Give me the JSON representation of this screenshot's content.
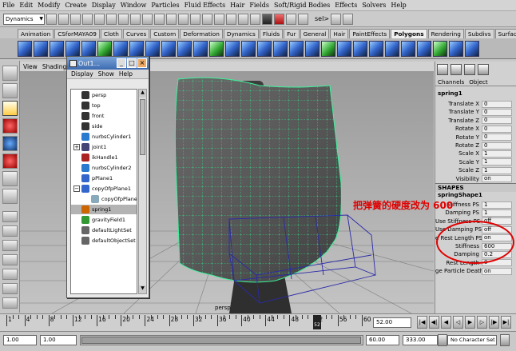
{
  "menubar": [
    "File",
    "Edit",
    "Modify",
    "Create",
    "Display",
    "Window",
    "Particles",
    "Fluid Effects",
    "Hair",
    "Fields",
    "Soft/Rigid Bodies",
    "Effects",
    "Solvers",
    "Help"
  ],
  "status": {
    "mode": "Dynamics",
    "sel_label": "sel>"
  },
  "shelf_tabs": [
    "Animation",
    "CSforMAYA09",
    "Cloth",
    "Curves",
    "Custom",
    "Deformation",
    "Dynamics",
    "Fluids",
    "Fur",
    "General",
    "Hair",
    "PaintEffects",
    "Polygons",
    "Rendering",
    "Subdivs",
    "Surfaces"
  ],
  "shelf_active": "Polygons",
  "viewport": {
    "menu": [
      "View",
      "Shading"
    ],
    "camera_label": "persp"
  },
  "outliner": {
    "title": "Out1...",
    "menu": [
      "Display",
      "Show",
      "Help"
    ],
    "items": [
      {
        "name": "persp",
        "icon": "camera-icon",
        "expander": ""
      },
      {
        "name": "top",
        "icon": "camera-icon",
        "expander": ""
      },
      {
        "name": "front",
        "icon": "camera-icon",
        "expander": ""
      },
      {
        "name": "side",
        "icon": "camera-icon",
        "expander": ""
      },
      {
        "name": "nurbsCylinder1",
        "icon": "nurbs-icon",
        "expander": ""
      },
      {
        "name": "joint1",
        "icon": "joint-icon",
        "expander": "+"
      },
      {
        "name": "ikHandle1",
        "icon": "ik-handle-icon",
        "expander": ""
      },
      {
        "name": "nurbsCylinder2",
        "icon": "nurbs-icon",
        "expander": ""
      },
      {
        "name": "pPlane1",
        "icon": "poly-icon",
        "expander": ""
      },
      {
        "name": "copyOfpPlane1",
        "icon": "poly-icon",
        "expander": "−"
      },
      {
        "name": "copyOfpPlane",
        "icon": "poly-shape-icon",
        "expander": ""
      },
      {
        "name": "spring1",
        "icon": "spring-icon",
        "expander": ""
      },
      {
        "name": "gravityField1",
        "icon": "field-icon",
        "expander": ""
      },
      {
        "name": "defaultLightSet",
        "icon": "set-icon",
        "expander": ""
      },
      {
        "name": "defaultObjectSet",
        "icon": "set-icon",
        "expander": ""
      }
    ]
  },
  "channel_box": {
    "tabs": [
      "Channels",
      "Object"
    ],
    "node": "spring1",
    "attrs": [
      {
        "label": "Translate X",
        "value": "0"
      },
      {
        "label": "Translate Y",
        "value": "0"
      },
      {
        "label": "Translate Z",
        "value": "0"
      },
      {
        "label": "Rotate X",
        "value": "0"
      },
      {
        "label": "Rotate Y",
        "value": "0"
      },
      {
        "label": "Rotate Z",
        "value": "0"
      },
      {
        "label": "Scale X",
        "value": "1"
      },
      {
        "label": "Scale Y",
        "value": "1"
      },
      {
        "label": "Scale Z",
        "value": "1"
      },
      {
        "label": "Visibility",
        "value": "on"
      }
    ],
    "shapes_label": "SHAPES",
    "shape_node": "springShape1",
    "shape_attrs": [
      {
        "label": "Stiffness PS",
        "value": "1"
      },
      {
        "label": "Damping PS",
        "value": "1"
      },
      {
        "label": "Use Stiffness PS",
        "value": "off"
      },
      {
        "label": "Use Damping PS",
        "value": "off"
      },
      {
        "label": "e Rest Length PS",
        "value": "on"
      },
      {
        "label": "Stiffness",
        "value": "600"
      },
      {
        "label": "Damping",
        "value": "0.2"
      },
      {
        "label": "Rest Length",
        "value": "0"
      },
      {
        "label": "ge Particle Death",
        "value": "on"
      }
    ]
  },
  "annotation": "把弹簧的硬度改为 600",
  "timeline": {
    "ticks": [
      "1",
      "4",
      "8",
      "12",
      "16",
      "20",
      "24",
      "28",
      "32",
      "36",
      "40",
      "44",
      "48",
      "52",
      "56",
      "60"
    ],
    "current_frame": "52",
    "current_time": "52.00"
  },
  "range": {
    "start": "1.00",
    "start_inner": "1.00",
    "end_inner": "60.00",
    "end": "333.00",
    "character_set": "No Character Set"
  }
}
